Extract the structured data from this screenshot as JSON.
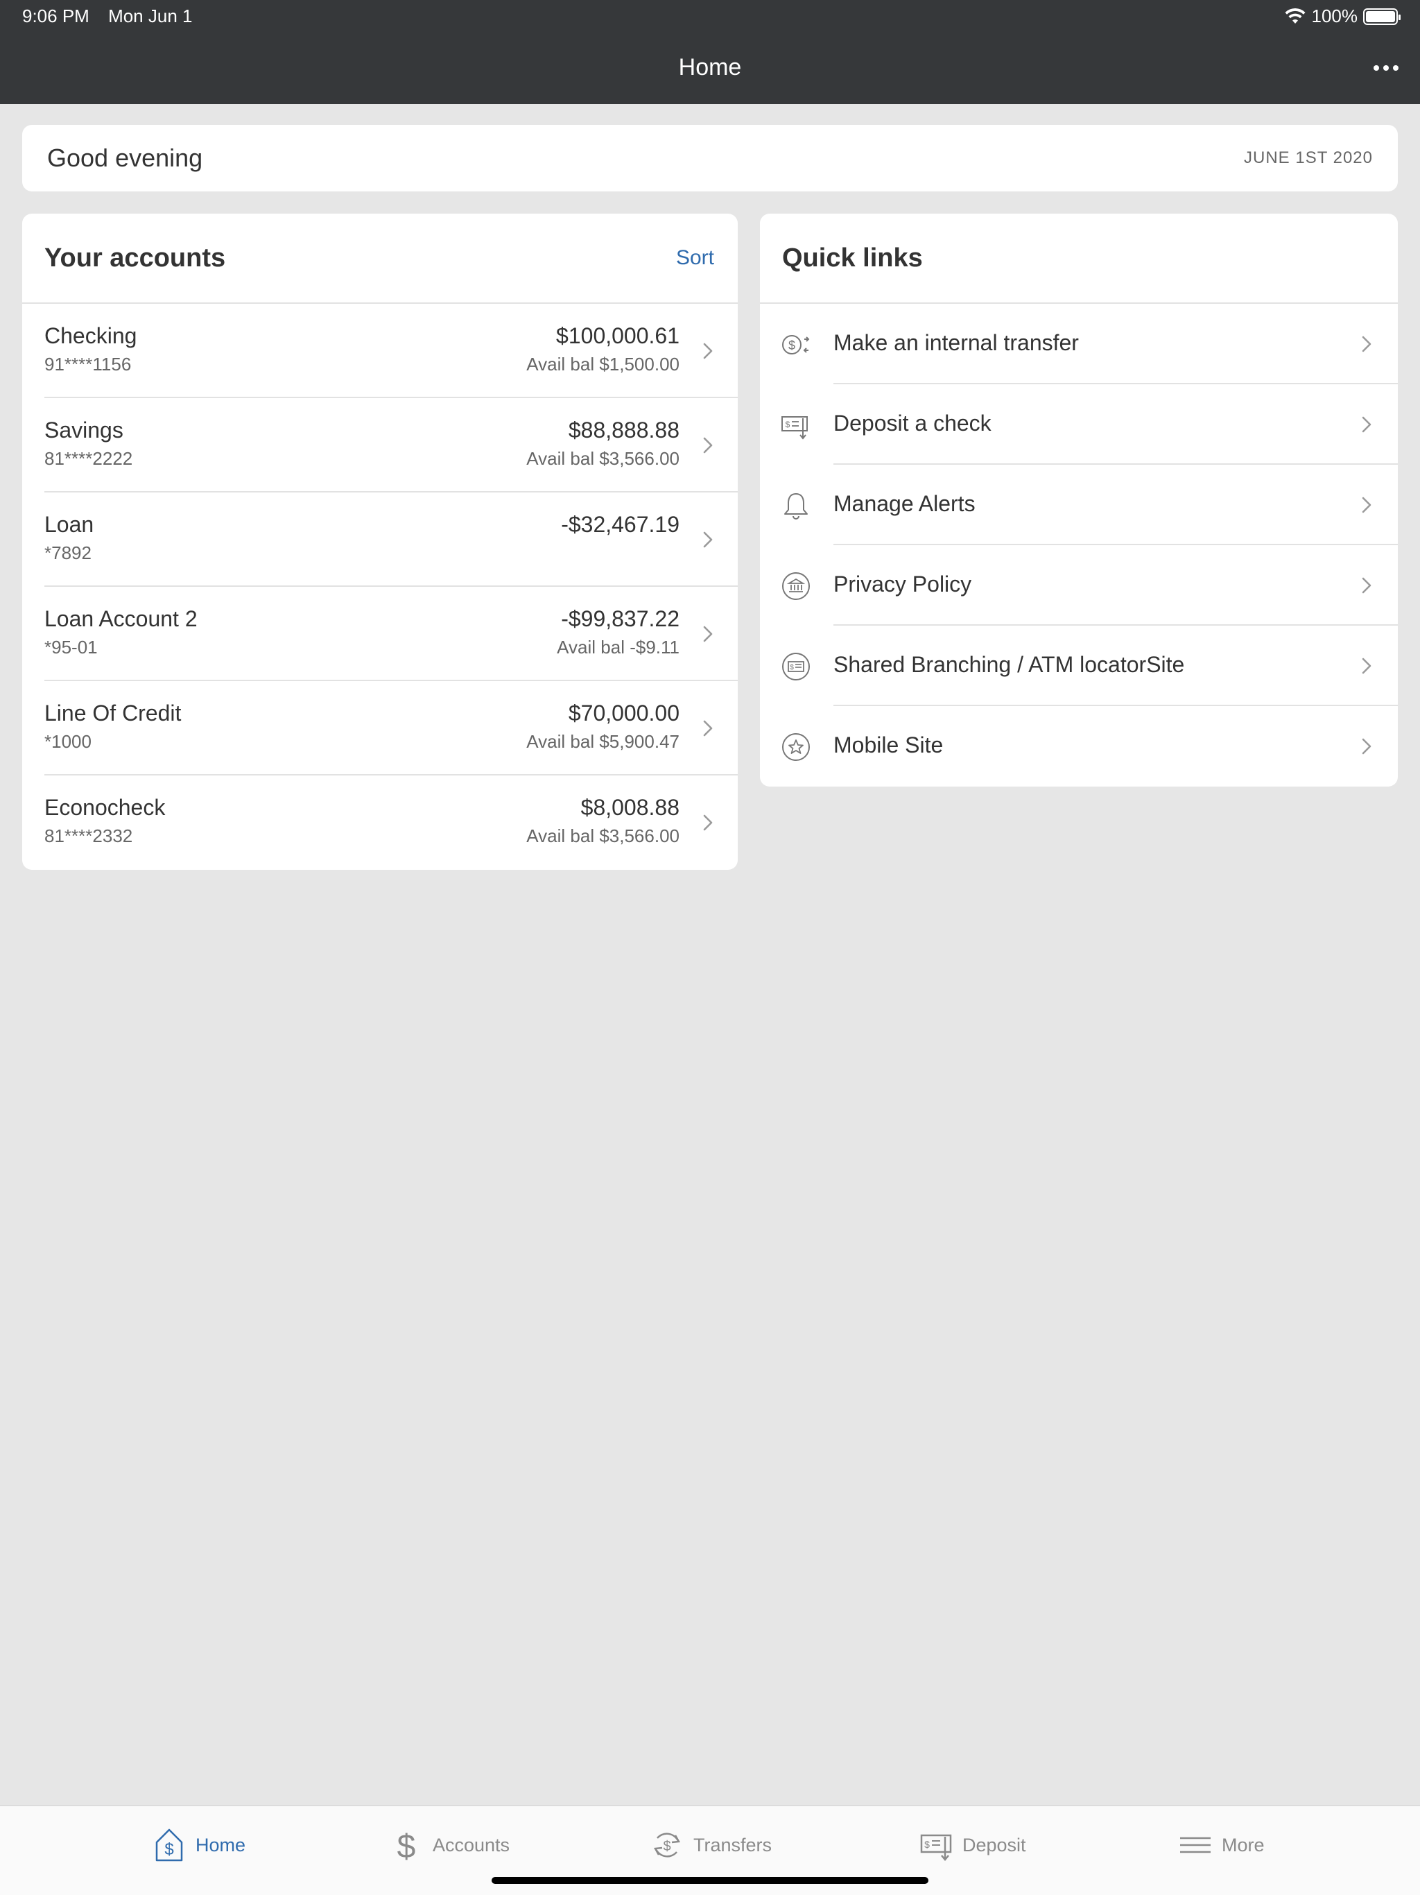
{
  "status_bar": {
    "time": "9:06 PM",
    "date": "Mon Jun 1",
    "battery": "100%"
  },
  "nav": {
    "title": "Home"
  },
  "greeting": {
    "text": "Good evening",
    "date": "JUNE 1ST 2020"
  },
  "accounts": {
    "title": "Your accounts",
    "sort_label": "Sort",
    "items": [
      {
        "name": "Checking",
        "number": "91****1156",
        "balance": "$100,000.61",
        "avail": "Avail bal $1,500.00"
      },
      {
        "name": "Savings",
        "number": "81****2222",
        "balance": "$88,888.88",
        "avail": "Avail bal $3,566.00"
      },
      {
        "name": "Loan",
        "number": "*7892",
        "balance": "-$32,467.19",
        "avail": ""
      },
      {
        "name": "Loan Account 2",
        "number": "*95-01",
        "balance": "-$99,837.22",
        "avail": "Avail bal -$9.11"
      },
      {
        "name": "Line Of Credit",
        "number": "*1000",
        "balance": "$70,000.00",
        "avail": "Avail bal $5,900.47"
      },
      {
        "name": "Econocheck",
        "number": "81****2332",
        "balance": "$8,008.88",
        "avail": "Avail bal $3,566.00"
      }
    ]
  },
  "quick_links": {
    "title": "Quick links",
    "items": [
      {
        "label": "Make an internal transfer",
        "icon": "transfer-icon"
      },
      {
        "label": "Deposit a check",
        "icon": "check-deposit-icon"
      },
      {
        "label": "Manage Alerts",
        "icon": "bell-icon"
      },
      {
        "label": "Privacy Policy",
        "icon": "bank-icon"
      },
      {
        "label": "Shared Branching / ATM locatorSite",
        "icon": "atm-icon"
      },
      {
        "label": "Mobile Site",
        "icon": "star-icon"
      }
    ]
  },
  "tabbar": {
    "tabs": [
      {
        "label": "Home",
        "icon": "home-dollar-icon",
        "active": true
      },
      {
        "label": "Accounts",
        "icon": "dollar-icon",
        "active": false
      },
      {
        "label": "Transfers",
        "icon": "transfer-cycle-icon",
        "active": false
      },
      {
        "label": "Deposit",
        "icon": "check-deposit-icon",
        "active": false
      },
      {
        "label": "More",
        "icon": "menu-icon",
        "active": false
      }
    ]
  },
  "colors": {
    "nav_bg": "#36383a",
    "accent": "#2f6bad",
    "page_bg": "#e6e6e6"
  }
}
